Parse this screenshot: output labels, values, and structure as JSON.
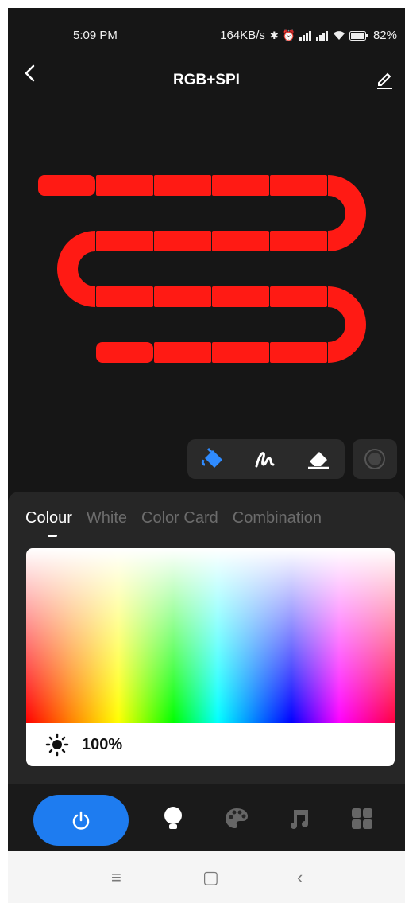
{
  "status_bar": {
    "time": "5:09 PM",
    "network_speed": "164KB/s",
    "battery": "82%",
    "icons": [
      "bluetooth-icon",
      "alarm-icon",
      "signal-icon",
      "signal-icon",
      "wifi-icon",
      "battery-icon"
    ]
  },
  "header": {
    "title": "RGB+SPI",
    "back_icon": "chevron-left-icon",
    "edit_icon": "pencil-icon"
  },
  "strip": {
    "color": "#ff1a14",
    "segment_count": 20
  },
  "toolbar": {
    "tools": [
      "paint-bucket-icon",
      "brush-icon",
      "eraser-icon"
    ],
    "active_tool": "paint-bucket-icon",
    "record_icon": "record-icon"
  },
  "panel": {
    "tabs": [
      {
        "label": "Colour",
        "active": true
      },
      {
        "label": "White",
        "active": false
      },
      {
        "label": "Color Card",
        "active": false
      },
      {
        "label": "Combination",
        "active": false
      }
    ],
    "selected_color": "#ee0f0f",
    "brightness": "100%"
  },
  "bottom_nav": {
    "items": [
      "power-icon",
      "bulb-icon",
      "palette-icon",
      "music-icon",
      "grid-icon"
    ],
    "accent": "#1e7cf0"
  },
  "system_nav": {
    "menu": "≡",
    "home": "▢",
    "back": "‹"
  }
}
